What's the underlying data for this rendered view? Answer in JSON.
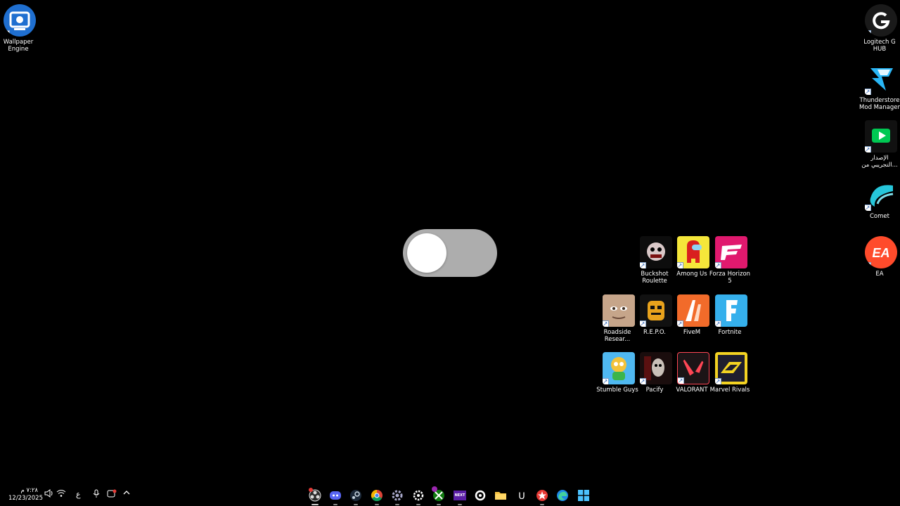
{
  "desktop": {
    "left_icons": [
      {
        "label": "Wallpaper\nEngine",
        "icon": "wallpaper-engine-icon"
      }
    ],
    "right_column": [
      {
        "label": "Logitech G\nHUB",
        "icon": "logitech-g-hub-icon"
      },
      {
        "label": "Thunderstore\nMod Manager",
        "icon": "thunderstore-icon"
      },
      {
        "label": "الإصدار\nالتجريبي من...",
        "icon": "google-play-games-icon"
      },
      {
        "label": "Comet",
        "icon": "comet-icon"
      },
      {
        "label": "EA",
        "icon": "ea-icon"
      }
    ],
    "grid_icons": [
      {
        "label": "Buckshot\nRoulette",
        "icon": "buckshot-roulette-icon"
      },
      {
        "label": "Among Us",
        "icon": "among-us-icon"
      },
      {
        "label": "Forza Horizon\n5",
        "icon": "forza-horizon-icon"
      },
      {
        "label": "Roadside\nResear...",
        "icon": "roadside-research-icon"
      },
      {
        "label": "R.E.P.O.",
        "icon": "repo-icon"
      },
      {
        "label": "FiveM",
        "icon": "fivem-icon"
      },
      {
        "label": "Fortnite",
        "icon": "fortnite-icon"
      },
      {
        "label": "Stumble Guys",
        "icon": "stumble-guys-icon"
      },
      {
        "label": "Pacify",
        "icon": "pacify-icon"
      },
      {
        "label": "VALORANT",
        "icon": "valorant-icon"
      },
      {
        "label": "Marvel Rivals",
        "icon": "marvel-rivals-icon"
      }
    ]
  },
  "overlay": {
    "toggle_state": "off"
  },
  "taskbar": {
    "clock": {
      "time": "٧:٢٨ م",
      "date": "12/23/2025"
    },
    "tray": {
      "language": "ع"
    },
    "apps": [
      {
        "name": "obs-icon"
      },
      {
        "name": "discord-icon"
      },
      {
        "name": "steam-icon"
      },
      {
        "name": "chrome-icon"
      },
      {
        "name": "settings-icon"
      },
      {
        "name": "steelseries-icon"
      },
      {
        "name": "xbox-icon"
      },
      {
        "name": "kick-icon"
      },
      {
        "name": "lens-icon"
      },
      {
        "name": "file-explorer-icon"
      },
      {
        "name": "ubisoft-icon"
      },
      {
        "name": "rockstar-icon"
      },
      {
        "name": "edge-icon"
      },
      {
        "name": "start-icon"
      }
    ],
    "kick_label": "NEXT"
  },
  "colors": {
    "background": "#000000",
    "toggle_track": "#adadad",
    "toggle_knob": "#ffffff",
    "valorant": "#ff4655",
    "fortnite": "#35b0ec",
    "fivem": "#f26b2a",
    "forza": "#e0196e",
    "ea": "#ff4b2b"
  }
}
